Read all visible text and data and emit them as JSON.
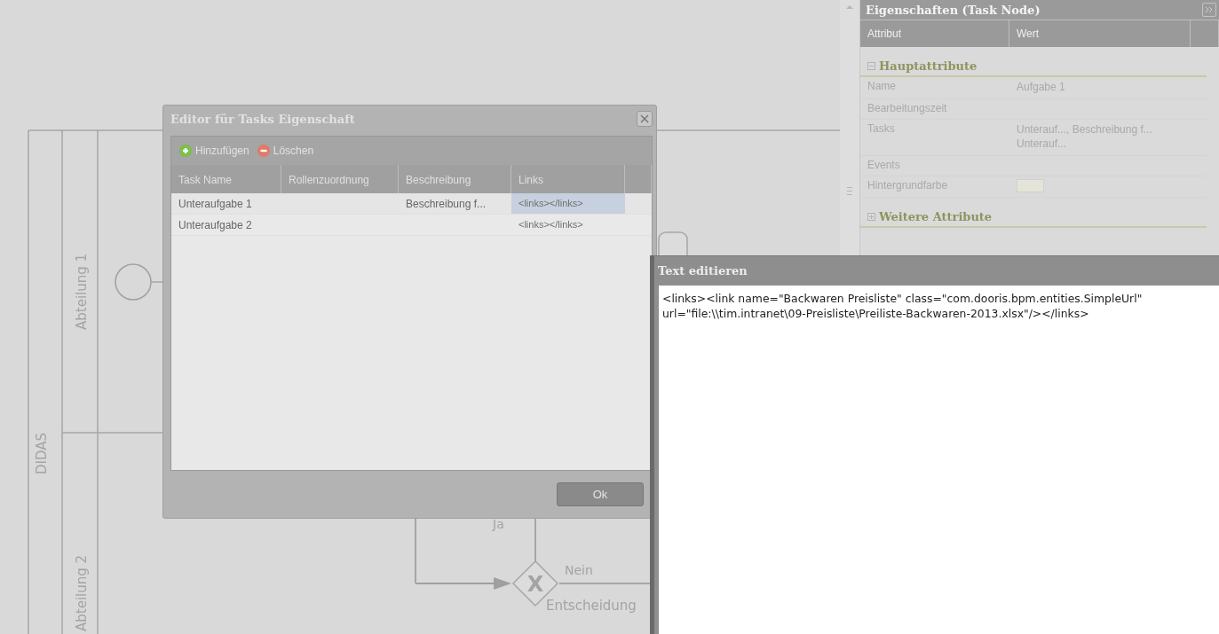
{
  "diagram": {
    "pool": "DIDAS",
    "lanes": [
      "Abteilung 1",
      "Abteilung 2"
    ],
    "gateway": {
      "symbol": "X",
      "label": "Entscheidung"
    },
    "flow_labels": [
      "Ja",
      "Nein"
    ]
  },
  "properties_panel": {
    "title": "Eigenschaften (Task Node)",
    "columns": [
      "Attribut",
      "Wert"
    ],
    "groups": [
      {
        "title": "Hauptattribute",
        "expanded": true,
        "rows": [
          {
            "kind": "text",
            "attribute": "Name",
            "value": "Aufgabe 1"
          },
          {
            "kind": "text",
            "attribute": "Bearbeitungszeit"
          },
          {
            "kind": "text",
            "attribute": "Tasks",
            "value": "Unterauf..., Beschreibung f...\nUnterauf..."
          },
          {
            "kind": "text",
            "attribute": "Events"
          },
          {
            "kind": "color",
            "attribute": "Hintergrundfarbe",
            "color": "#e4e4d8"
          }
        ]
      },
      {
        "title": "Weitere Attribute",
        "expanded": false
      }
    ]
  },
  "editor_dialog": {
    "title": "Editor für Tasks Eigenschaft",
    "toolbar": [
      {
        "kind": "add",
        "label": "Hinzufügen"
      },
      {
        "kind": "delete",
        "label": "Löschen"
      }
    ],
    "columns": [
      "Task Name",
      "Rollenzuordnung",
      "Beschreibung",
      "Links"
    ],
    "rows": [
      {
        "task_name": "Unteraufgabe 1",
        "description": "Beschreibung f...",
        "links": "<links></links>",
        "links_selected": true
      },
      {
        "task_name": "Unteraufgabe 2",
        "links": "<links></links>",
        "links_selected": false
      }
    ],
    "buttons": [
      "Ok"
    ]
  },
  "text_editor": {
    "title": "Text editieren",
    "value": "<links><link name=\"Backwaren Preisliste\" class=\"com.dooris.bpm.entities.SimpleUrl\" url=\"file:\\\\tim.intranet\\09-Preisliste\\Preiliste-Backwaren-2013.xlsx\"/></links>"
  }
}
